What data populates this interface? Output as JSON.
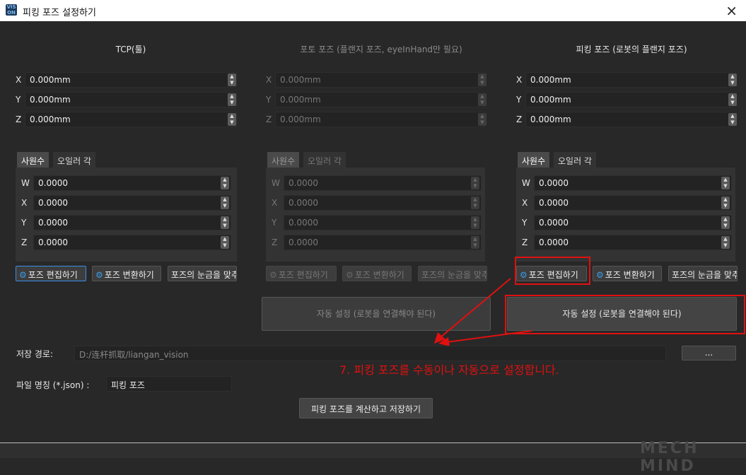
{
  "window": {
    "title": "피킹 포즈 설정하기",
    "close_icon": "×"
  },
  "columns": [
    {
      "title": "TCP(툴)",
      "xyz": [
        {
          "label": "X",
          "value": "0.000mm"
        },
        {
          "label": "Y",
          "value": "0.000mm"
        },
        {
          "label": "Z",
          "value": "0.000mm"
        }
      ],
      "tabs": [
        "사원수",
        "오일러 각"
      ],
      "quat": [
        {
          "label": "W",
          "value": "0.0000"
        },
        {
          "label": "X",
          "value": "0.0000"
        },
        {
          "label": "Y",
          "value": "0.0000"
        },
        {
          "label": "Z",
          "value": "0.0000"
        }
      ],
      "buttons": [
        "포즈 편집하기",
        "포즈 변환하기",
        "포즈의 눈금을 맞추"
      ]
    },
    {
      "title": "포토 포즈 (플랜지 포즈, eyeInHand만 필요)",
      "xyz": [
        {
          "label": "X",
          "value": "0.000mm"
        },
        {
          "label": "Y",
          "value": "0.000mm"
        },
        {
          "label": "Z",
          "value": "0.000mm"
        }
      ],
      "tabs": [
        "사원수",
        "오일러 각"
      ],
      "quat": [
        {
          "label": "W",
          "value": "0.0000"
        },
        {
          "label": "X",
          "value": "0.0000"
        },
        {
          "label": "Y",
          "value": "0.0000"
        },
        {
          "label": "Z",
          "value": "0.0000"
        }
      ],
      "buttons": [
        "포즈 편집하기",
        "포즈 변환하기",
        "포즈의 눈금을 맞추"
      ],
      "auto": "자동 설정 (로봇을 연결해야 된다)"
    },
    {
      "title": "피킹 포즈 (로봇의 플랜지 포즈)",
      "xyz": [
        {
          "label": "X",
          "value": "0.000mm"
        },
        {
          "label": "Y",
          "value": "0.000mm"
        },
        {
          "label": "Z",
          "value": "0.000mm"
        }
      ],
      "tabs": [
        "사원수",
        "오일러 각"
      ],
      "quat": [
        {
          "label": "W",
          "value": "0.0000"
        },
        {
          "label": "X",
          "value": "0.0000"
        },
        {
          "label": "Y",
          "value": "0.0000"
        },
        {
          "label": "Z",
          "value": "0.0000"
        }
      ],
      "buttons": [
        "포즈 편집하기",
        "포즈 변환하기",
        "포즈의 눈금을 맞추"
      ],
      "auto": "자동 설정 (로봇을 연결해야 된다)"
    }
  ],
  "path": {
    "label": "저장 경로:",
    "value": "D:/连杆抓取/liangan_vision",
    "browse": "..."
  },
  "file": {
    "label": "파일 명칭 (*.json) :",
    "value": "피킹 포즈"
  },
  "save_button": "피킹 포즈를 계산하고 저장하기",
  "annotation": "7. 피킹 포즈를 수동이나 자동으로 설정합니다.",
  "watermark": "MECH MIND",
  "colors": {
    "annotation": "#e01010",
    "accent": "#3a8ee6"
  }
}
